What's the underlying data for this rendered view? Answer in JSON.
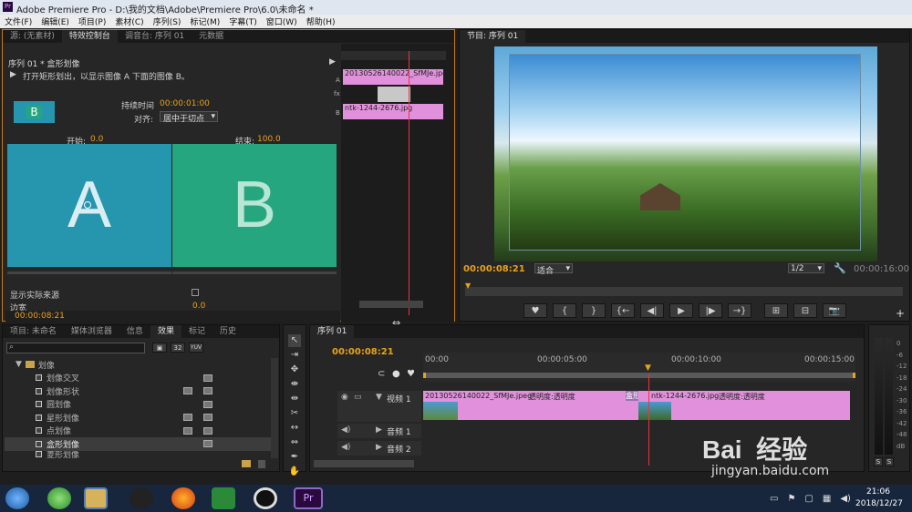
{
  "app": {
    "title": "Adobe Premiere Pro - D:\\我的文档\\Adobe\\Premiere Pro\\6.0\\未命名 *",
    "icon": "Pr"
  },
  "menu": [
    "文件(F)",
    "编辑(E)",
    "项目(P)",
    "素材(C)",
    "序列(S)",
    "标记(M)",
    "字幕(T)",
    "窗口(W)",
    "帮助(H)"
  ],
  "effect_panel": {
    "tabs": [
      "源: (无素材)",
      "特效控制台",
      "调音台: 序列 01",
      "元数据"
    ],
    "active_tab": "特效控制台",
    "sequence": "序列 01 * 盒形划像",
    "description": "打开矩形划出，以显示图像 A 下面的图像 B。",
    "duration_label": "持续时间",
    "duration_value": "00:00:01:00",
    "align_label": "对齐:",
    "align_value": "居中于切点",
    "start_label": "开始:",
    "start_value": "0.0",
    "end_label": "结束:",
    "end_value": "100.0",
    "a_letter": "A",
    "b_letter": "B",
    "show_source": "显示实际来源",
    "border": "边宽",
    "border_value": "0.0",
    "timecode": "00:00:08:21",
    "mini_clip_a": "20130526140022_SfMJe.jpeg",
    "mini_clip_b": "ntk-1244-2676.jpg",
    "mini_a": "A",
    "mini_fx": "fx",
    "mini_b": "B"
  },
  "program": {
    "tab": "节目: 序列 01",
    "timecode": "00:00:08:21",
    "fit": "适合",
    "quality": "1/2",
    "duration": "00:00:16:00"
  },
  "project": {
    "tabs": [
      "项目: 未命名",
      "媒体浏览器",
      "信息",
      "效果",
      "标记",
      "历史"
    ],
    "active_tab": "效果",
    "folder": "划像",
    "items": [
      "划像交叉",
      "划像形状",
      "圆划像",
      "星形划像",
      "点划像",
      "盒形划像",
      "菱形划像"
    ],
    "selected": "盒形划像"
  },
  "timeline": {
    "tab": "序列 01",
    "timecode": "00:00:08:21",
    "ruler": [
      "00:00",
      "00:00:05:00",
      "00:00:10:00",
      "00:00:15:00"
    ],
    "video_track": "视频 1",
    "audio1": "音频 1",
    "audio2": "音频 2",
    "clip1": "20130526140022_SfMJe.jpeg",
    "clip1_fx": "透明度:透明度",
    "transition": "盒形划",
    "clip2": "ntk-1244-2676.jpg",
    "clip2_fx": "透明度:透明度"
  },
  "meter": {
    "labels": [
      "0",
      "-6",
      "-12",
      "-18",
      "-24",
      "-30",
      "-36",
      "-42",
      "-48",
      "dB"
    ],
    "solo": "S"
  },
  "taskbar": {
    "time": "21:06",
    "date": "2018/12/27"
  },
  "watermark": {
    "brand": "Bai  经验",
    "url": "jingyan.baidu.com"
  },
  "colors": {
    "accent": "#e9a21a",
    "clip": "#e191db",
    "a": "#2596ad",
    "b": "#26a67e"
  }
}
